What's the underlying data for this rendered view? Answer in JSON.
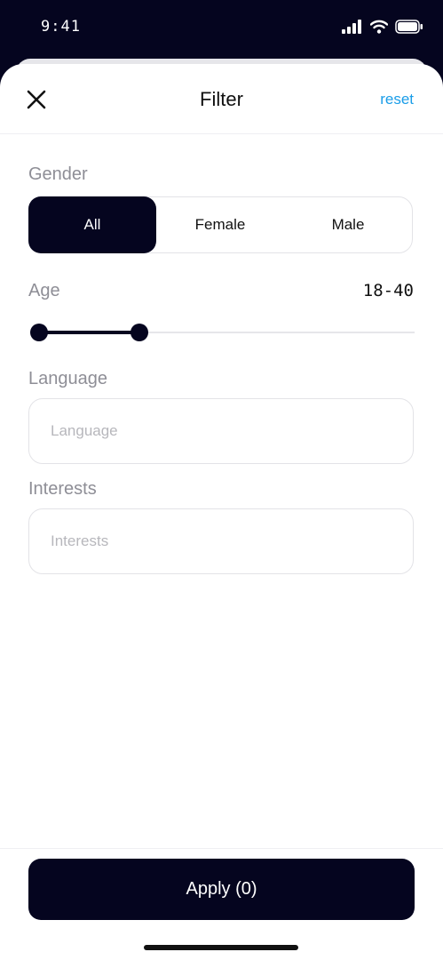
{
  "status_bar": {
    "time": "9:41"
  },
  "header": {
    "title": "Filter",
    "reset_label": "reset"
  },
  "gender": {
    "label": "Gender",
    "options": [
      "All",
      "Female",
      "Male"
    ],
    "selected": "All"
  },
  "age": {
    "label": "Age",
    "value_text": "18-40",
    "range": [
      18,
      100
    ],
    "selected_min": 18,
    "selected_max": 40
  },
  "language": {
    "label": "Language",
    "placeholder": "Language",
    "value": ""
  },
  "interests": {
    "label": "Interests",
    "placeholder": "Interests",
    "value": ""
  },
  "apply": {
    "label": "Apply (0)"
  },
  "colors": {
    "accent": "#05051F",
    "link": "#1A9DE8",
    "muted_label": "#8E8E96"
  }
}
